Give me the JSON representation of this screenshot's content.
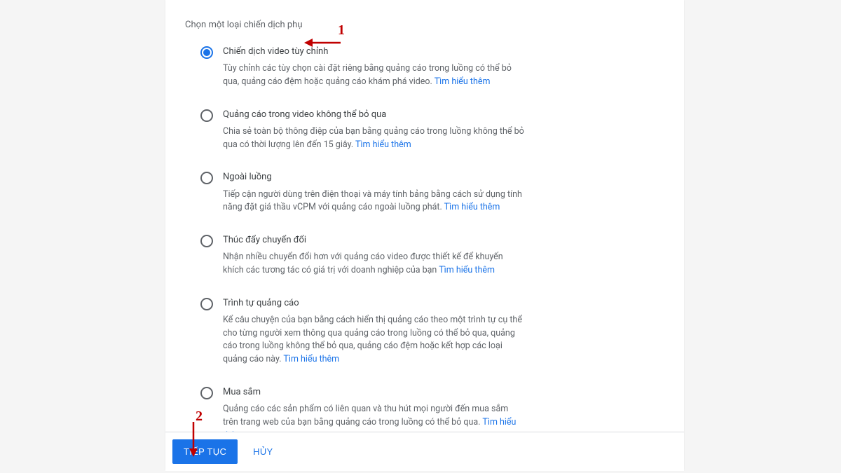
{
  "header": {
    "title": "Chọn một loại chiến dịch phụ"
  },
  "learn_more": "Tìm hiểu thêm",
  "options": [
    {
      "title": "Chiến dịch video tùy chỉnh",
      "desc": "Tùy chỉnh các tùy chọn cài đặt riêng bằng quảng cáo trong luồng có thể bỏ qua, quảng cáo đệm hoặc quảng cáo khám phá video.",
      "selected": true
    },
    {
      "title": "Quảng cáo trong video không thể bỏ qua",
      "desc": "Chia sẻ toàn bộ thông điệp của bạn bằng quảng cáo trong luồng không thể bỏ qua có thời lượng lên đến 15 giây.",
      "selected": false
    },
    {
      "title": "Ngoài luồng",
      "desc": "Tiếp cận người dùng trên điện thoại và máy tính bảng bằng cách sử dụng tính năng đặt giá thầu vCPM với quảng cáo ngoài luồng phát.",
      "selected": false
    },
    {
      "title": "Thúc đẩy chuyển đổi",
      "desc": "Nhận nhiều chuyển đổi hơn với quảng cáo video được thiết kế để khuyến khích các tương tác có giá trị với doanh nghiệp của bạn",
      "selected": false
    },
    {
      "title": "Trình tự quảng cáo",
      "desc": "Kể câu chuyện của bạn bằng cách hiển thị quảng cáo theo một trình tự cụ thể cho từng người xem thông qua quảng cáo trong luồng có thể bỏ qua, quảng cáo trong luồng không thể bỏ qua, quảng cáo đệm hoặc kết hợp các loại quảng cáo này.",
      "selected": false
    },
    {
      "title": "Mua sắm",
      "desc": "Quảng cáo các sản phẩm có liên quan và thu hút mọi người đến mua sắm trên trang web của bạn bằng quảng cáo trong luồng có thể bỏ qua.",
      "selected": false
    }
  ],
  "footer": {
    "continue": "TIẾP TỤC",
    "cancel": "HỦY"
  },
  "annotations": {
    "one": "1",
    "two": "2"
  }
}
